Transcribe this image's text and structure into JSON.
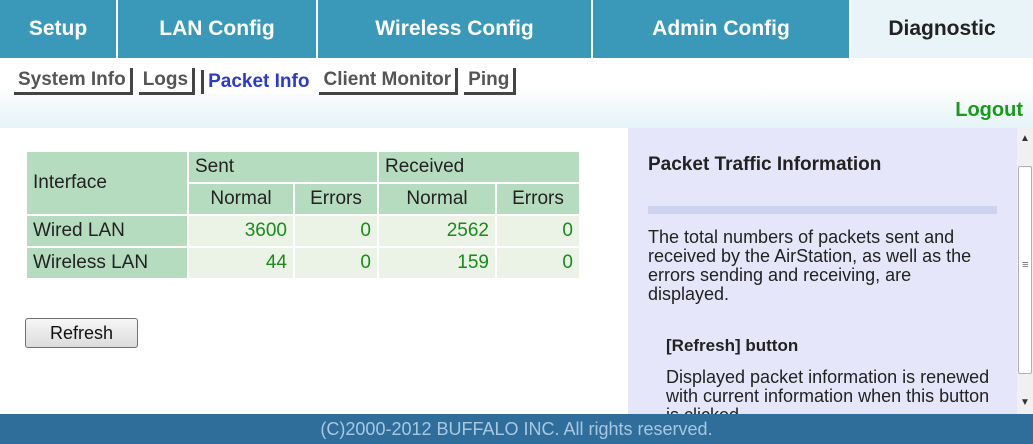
{
  "topnav": {
    "tabs": [
      {
        "label": "Setup"
      },
      {
        "label": "LAN Config"
      },
      {
        "label": "Wireless Config"
      },
      {
        "label": "Admin Config"
      },
      {
        "label": "Diagnostic"
      }
    ]
  },
  "subnav": {
    "tabs": [
      {
        "label": "System Info"
      },
      {
        "label": "Logs"
      },
      {
        "label": "Packet Info"
      },
      {
        "label": "Client Monitor"
      },
      {
        "label": "Ping"
      }
    ],
    "logout": "Logout"
  },
  "table": {
    "interface_header": "Interface",
    "sent_header": "Sent",
    "received_header": "Received",
    "normal_label": "Normal",
    "errors_label": "Errors",
    "rows": [
      {
        "name": "Wired LAN",
        "sent_normal": "3600",
        "sent_errors": "0",
        "recv_normal": "2562",
        "recv_errors": "0"
      },
      {
        "name": "Wireless LAN",
        "sent_normal": "44",
        "sent_errors": "0",
        "recv_normal": "159",
        "recv_errors": "0"
      }
    ]
  },
  "refresh_label": "Refresh",
  "help": {
    "title": "Packet Traffic Information",
    "description": "The total numbers of packets sent and received by the AirStation, as well as the errors sending and receiving, are displayed.",
    "refresh_title": "[Refresh] button",
    "refresh_desc": "Displayed packet information is renewed with current information when this button is clicked."
  },
  "footer": "(C)2000-2012 BUFFALO INC. All rights reserved.",
  "colors": {
    "nav": "#3a98b9",
    "table_header": "#b6dcbf",
    "value_text": "#1a8a1a",
    "help_bg": "#e6e6fa",
    "footer": "#2f6e9a"
  }
}
